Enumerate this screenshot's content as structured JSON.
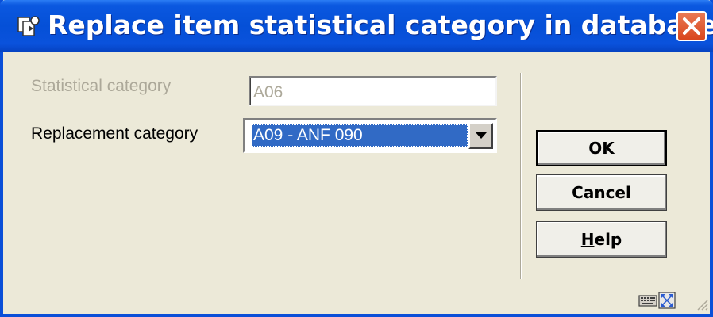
{
  "window": {
    "title": "Replace item statistical category in database",
    "accent": "#0550d7"
  },
  "form": {
    "statistical_category_label": "Statistical category",
    "statistical_category_value": "A06",
    "replacement_category_label": "Replacement category",
    "replacement_category_value": "A09 - ANF 090"
  },
  "buttons": {
    "ok": "OK",
    "cancel": "Cancel",
    "help_prefix": "H",
    "help_rest": "elp"
  },
  "icons": {
    "title": "app-icon",
    "close": "close-icon",
    "dropdown": "chevron-down-icon",
    "status1": "keyboard-icon",
    "status2": "resize-icon",
    "grip": "resize-grip-icon"
  }
}
